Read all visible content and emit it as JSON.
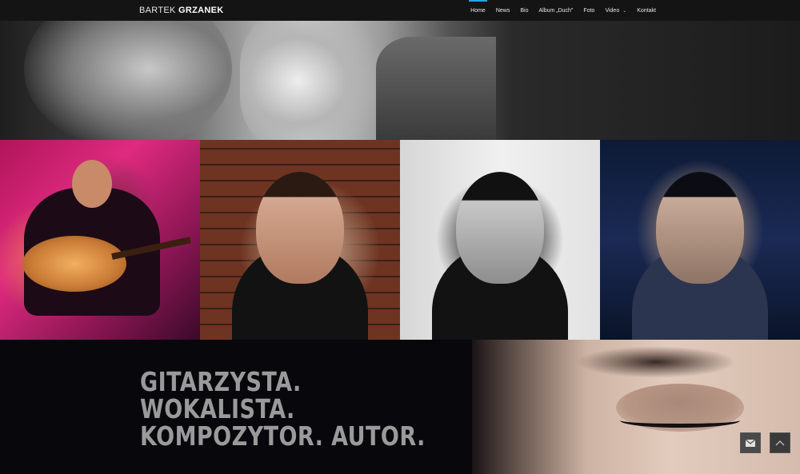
{
  "header": {
    "logo": {
      "light": "BARTEK",
      "bold": "GRZANEK"
    },
    "nav": [
      {
        "label": "Home",
        "active": true
      },
      {
        "label": "News"
      },
      {
        "label": "Bio"
      },
      {
        "label": "Album „Duch\""
      },
      {
        "label": "Foto"
      },
      {
        "label": "Video",
        "has_dropdown": true
      },
      {
        "label": "Kontakt"
      }
    ],
    "accent_color": "#2aa3e0"
  },
  "tagline": {
    "line1": "GITARZYSTA.",
    "line2": "WOKALISTA.",
    "line3": "KOMPOZYTOR. AUTOR."
  },
  "icons": {
    "mail": "envelope-icon",
    "scroll_top": "chevron-up-icon",
    "dropdown": "chevron-down-icon"
  }
}
